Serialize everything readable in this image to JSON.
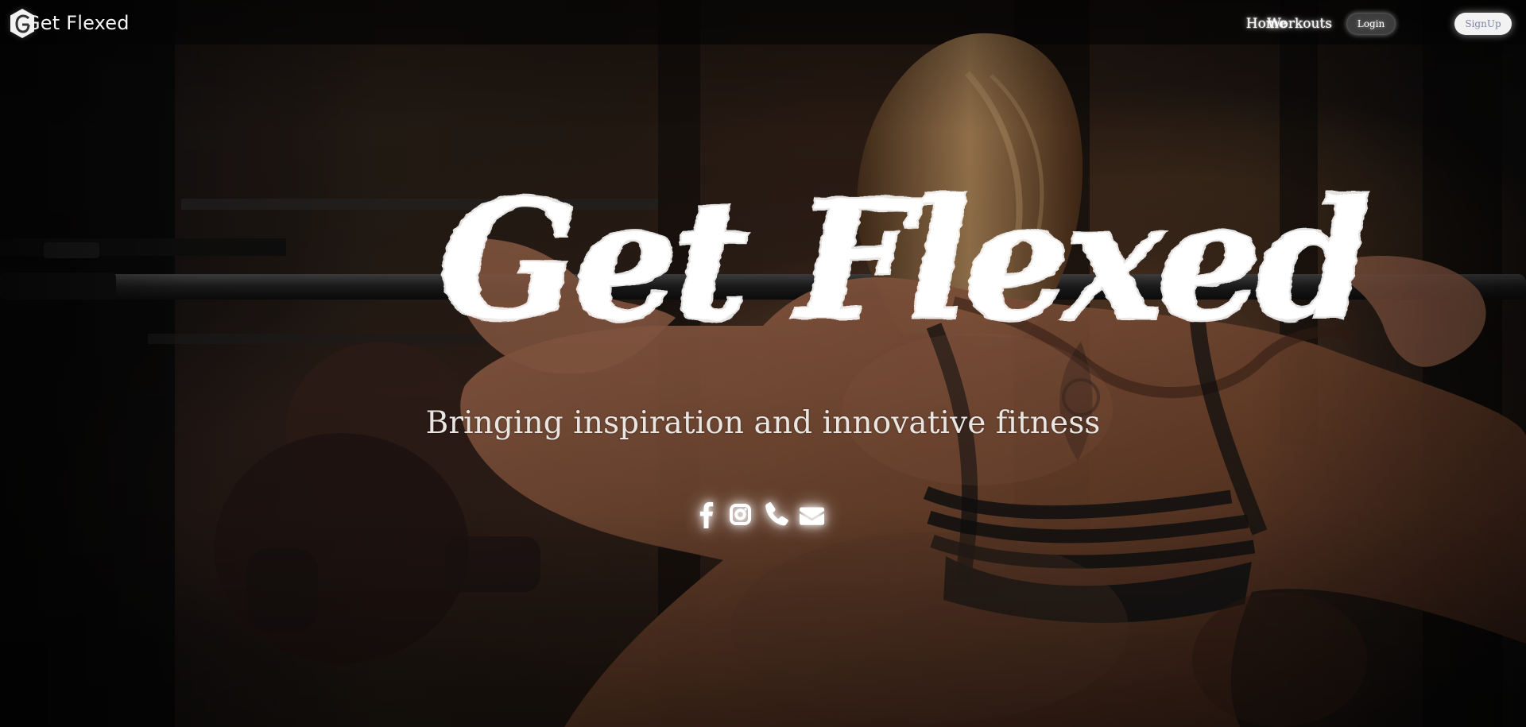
{
  "brand": {
    "name": "Get Flexed"
  },
  "nav": {
    "links": [
      "Home",
      "Workouts"
    ],
    "login_label": "Login",
    "signup_label": "SignUp"
  },
  "hero": {
    "title": "Get Flexed",
    "subtitle": "Bringing inspiration and innovative fitness"
  },
  "social_links": [
    {
      "icon": "facebook-icon"
    },
    {
      "icon": "instagram-icon"
    },
    {
      "icon": "phone-icon"
    },
    {
      "icon": "envelope-icon"
    }
  ],
  "colors": {
    "text": "#ffffff",
    "subtitle": "#e9e5e1",
    "signup_text": "#7c839e",
    "login_background": "#484848"
  }
}
